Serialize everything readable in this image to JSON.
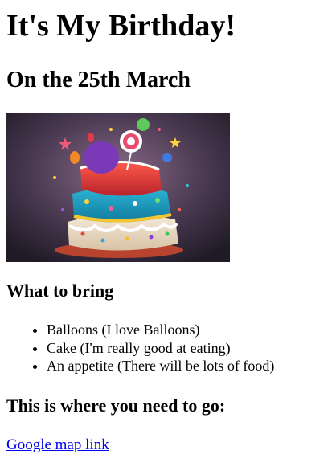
{
  "page": {
    "title": "It's My Birthday!",
    "date_heading": "On the 25th March"
  },
  "image": {
    "alt": "Birthday cake"
  },
  "bring_section": {
    "heading": "What to bring",
    "items": [
      "Balloons (I love Balloons)",
      "Cake (I'm really good at eating)",
      "An appetite (There will be lots of food)"
    ]
  },
  "directions": {
    "heading": "This is where you need to go:",
    "link_text": "Google map link"
  },
  "colors": {
    "link": "#0000ee",
    "text": "#000000",
    "background": "#ffffff"
  }
}
